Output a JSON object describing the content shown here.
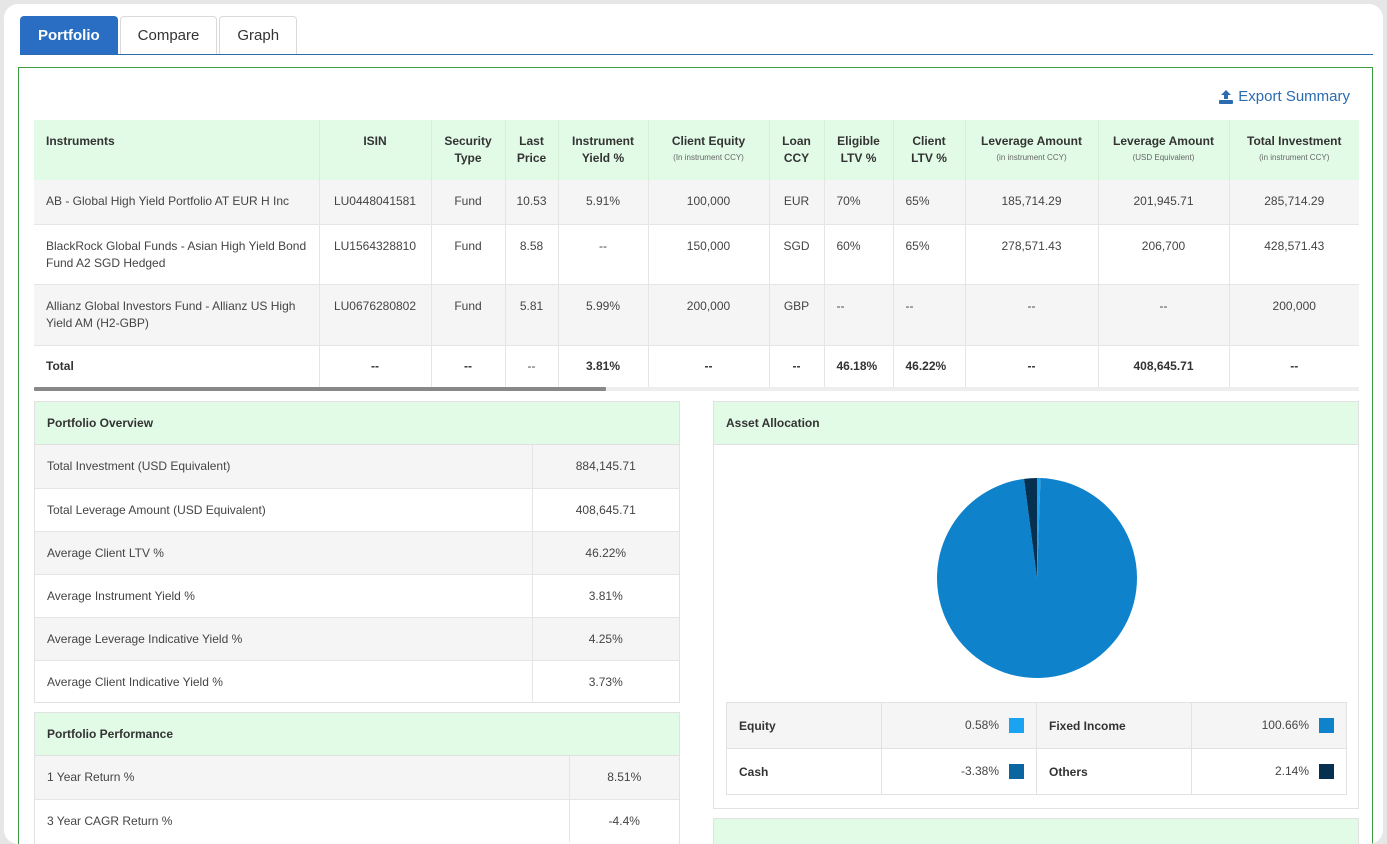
{
  "tabs": [
    {
      "label": "Portfolio",
      "active": true
    },
    {
      "label": "Compare",
      "active": false
    },
    {
      "label": "Graph",
      "active": false
    }
  ],
  "export_label": "Export Summary",
  "instruments_table": {
    "headers": [
      {
        "label": "Instruments",
        "sub": ""
      },
      {
        "label": "ISIN",
        "sub": ""
      },
      {
        "label": "Security Type",
        "sub": ""
      },
      {
        "label": "Last Price",
        "sub": ""
      },
      {
        "label": "Instrument Yield %",
        "sub": ""
      },
      {
        "label": "Client Equity",
        "sub": "(In instrument CCY)"
      },
      {
        "label": "Loan CCY",
        "sub": ""
      },
      {
        "label": "Eligible LTV %",
        "sub": ""
      },
      {
        "label": "Client LTV %",
        "sub": ""
      },
      {
        "label": "Leverage Amount",
        "sub": "(in instrument CCY)"
      },
      {
        "label": "Leverage Amount",
        "sub": "(USD Equivalent)"
      },
      {
        "label": "Total Investment",
        "sub": "(in instrument CCY)"
      }
    ],
    "rows": [
      [
        "AB - Global High Yield Portfolio AT EUR H Inc",
        "LU0448041581",
        "Fund",
        "10.53",
        "5.91%",
        "100,000",
        "EUR",
        "70%",
        "65%",
        "185,714.29",
        "201,945.71",
        "285,714.29"
      ],
      [
        "BlackRock Global Funds - Asian High Yield Bond Fund A2 SGD Hedged",
        "LU1564328810",
        "Fund",
        "8.58",
        "--",
        "150,000",
        "SGD",
        "60%",
        "65%",
        "278,571.43",
        "206,700",
        "428,571.43"
      ],
      [
        "Allianz Global Investors Fund - Allianz US High Yield AM (H2-GBP)",
        "LU0676280802",
        "Fund",
        "5.81",
        "5.99%",
        "200,000",
        "GBP",
        "--",
        "--",
        "--",
        "--",
        "200,000"
      ]
    ],
    "total": [
      "Total",
      "--",
      "--",
      "--",
      "3.81%",
      "--",
      "--",
      "46.18%",
      "46.22%",
      "--",
      "408,645.71",
      "--"
    ]
  },
  "portfolio_overview": {
    "title": "Portfolio Overview",
    "rows": [
      {
        "label": "Total Investment (USD Equivalent)",
        "value": "884,145.71"
      },
      {
        "label": "Total Leverage Amount (USD Equivalent)",
        "value": "408,645.71"
      },
      {
        "label": "Average Client LTV %",
        "value": "46.22%"
      },
      {
        "label": "Average Instrument Yield %",
        "value": "3.81%"
      },
      {
        "label": "Average Leverage Indicative Yield %",
        "value": "4.25%"
      },
      {
        "label": "Average Client Indicative Yield %",
        "value": "3.73%"
      }
    ]
  },
  "portfolio_performance": {
    "title": "Portfolio Performance",
    "rows": [
      {
        "label": "1 Year Return %",
        "value": "8.51%",
        "trend": "positive"
      },
      {
        "label": "3 Year CAGR Return %",
        "value": "-4.4%",
        "trend": "negative"
      }
    ]
  },
  "asset_allocation": {
    "title": "Asset Allocation",
    "legend": [
      {
        "name": "Equity",
        "value": "0.58%",
        "color": "#1aa3f0"
      },
      {
        "name": "Fixed Income",
        "value": "100.66%",
        "color": "#0f82cc"
      },
      {
        "name": "Cash",
        "value": "-3.38%",
        "color": "#0b65a0"
      },
      {
        "name": "Others",
        "value": "2.14%",
        "color": "#06304f"
      }
    ]
  },
  "next_panel_title": "",
  "colors": {
    "tab_active": "#2a6ec4",
    "header_bg": "#e2fbe7",
    "border_green": "#3f9b3f",
    "link": "#2b6cb0",
    "positive": "#3a9a3a",
    "negative": "#e04848"
  },
  "chart_data": {
    "type": "pie",
    "title": "Asset Allocation",
    "categories": [
      "Equity",
      "Fixed Income",
      "Cash",
      "Others"
    ],
    "values": [
      0.58,
      100.66,
      -3.38,
      2.14
    ],
    "colors": [
      "#1aa3f0",
      "#0f82cc",
      "#0b65a0",
      "#06304f"
    ],
    "legend": "bottom-table"
  }
}
